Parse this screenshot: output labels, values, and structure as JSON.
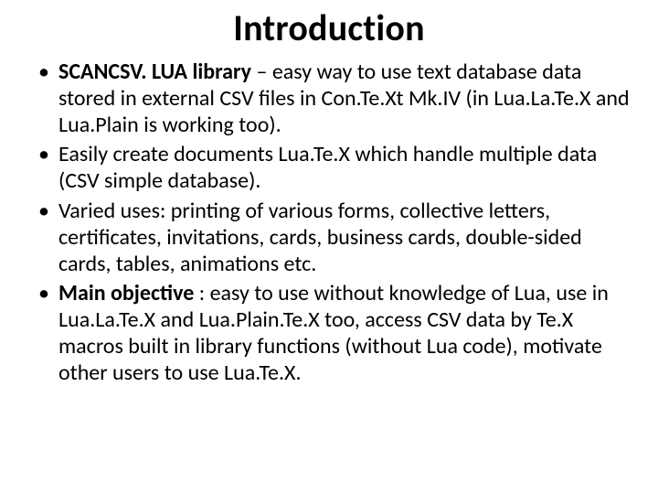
{
  "title": "Introduction",
  "bullets": [
    {
      "lead_bold": "SCANCSV. LUA library",
      "rest": " – easy way to use text database data stored in external CSV files in Con.Te.Xt Mk.IV (in Lua.La.Te.X and Lua.Plain is working too)."
    },
    {
      "lead_bold": "",
      "rest": "Easily create documents Lua.Te.X which handle multiple data (CSV simple database)."
    },
    {
      "lead_bold": "",
      "rest": "Varied uses: printing of various forms, collective letters, certificates, invitations, cards, business cards, double-sided cards, tables, animations etc."
    },
    {
      "lead_bold": "Main objective ",
      "rest": ": easy to use without knowledge of Lua, use in Lua.La.Te.X  and Lua.Plain.Te.X too, access CSV data by Te.X macros built in library functions (without Lua code), motivate other users to use Lua.Te.X."
    }
  ]
}
